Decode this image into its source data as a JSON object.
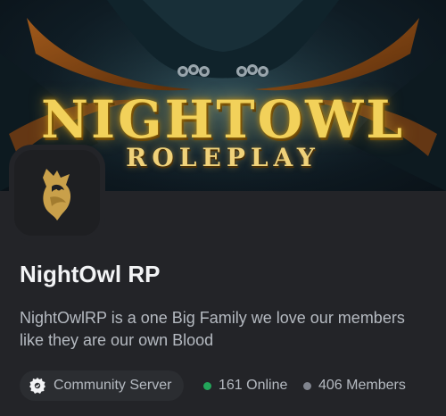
{
  "banner": {
    "title": "NIGHTOWL",
    "subtitle": "ROLEPLAY"
  },
  "server": {
    "name": "NightOwl RP",
    "description": "NightOwlRP is a one Big Family we love our members like they are our own Blood"
  },
  "tags": {
    "community_label": "Community Server",
    "online_label": "161 Online",
    "members_label": "406 Members"
  },
  "colors": {
    "background": "#232428",
    "online_dot": "#23a55a",
    "members_dot": "#80848e",
    "banner_gold": "#f2d15a",
    "logo_gold": "#c9a04a"
  },
  "icons": {
    "server_logo": "owl-head-icon",
    "community": "gear-badge-icon"
  }
}
